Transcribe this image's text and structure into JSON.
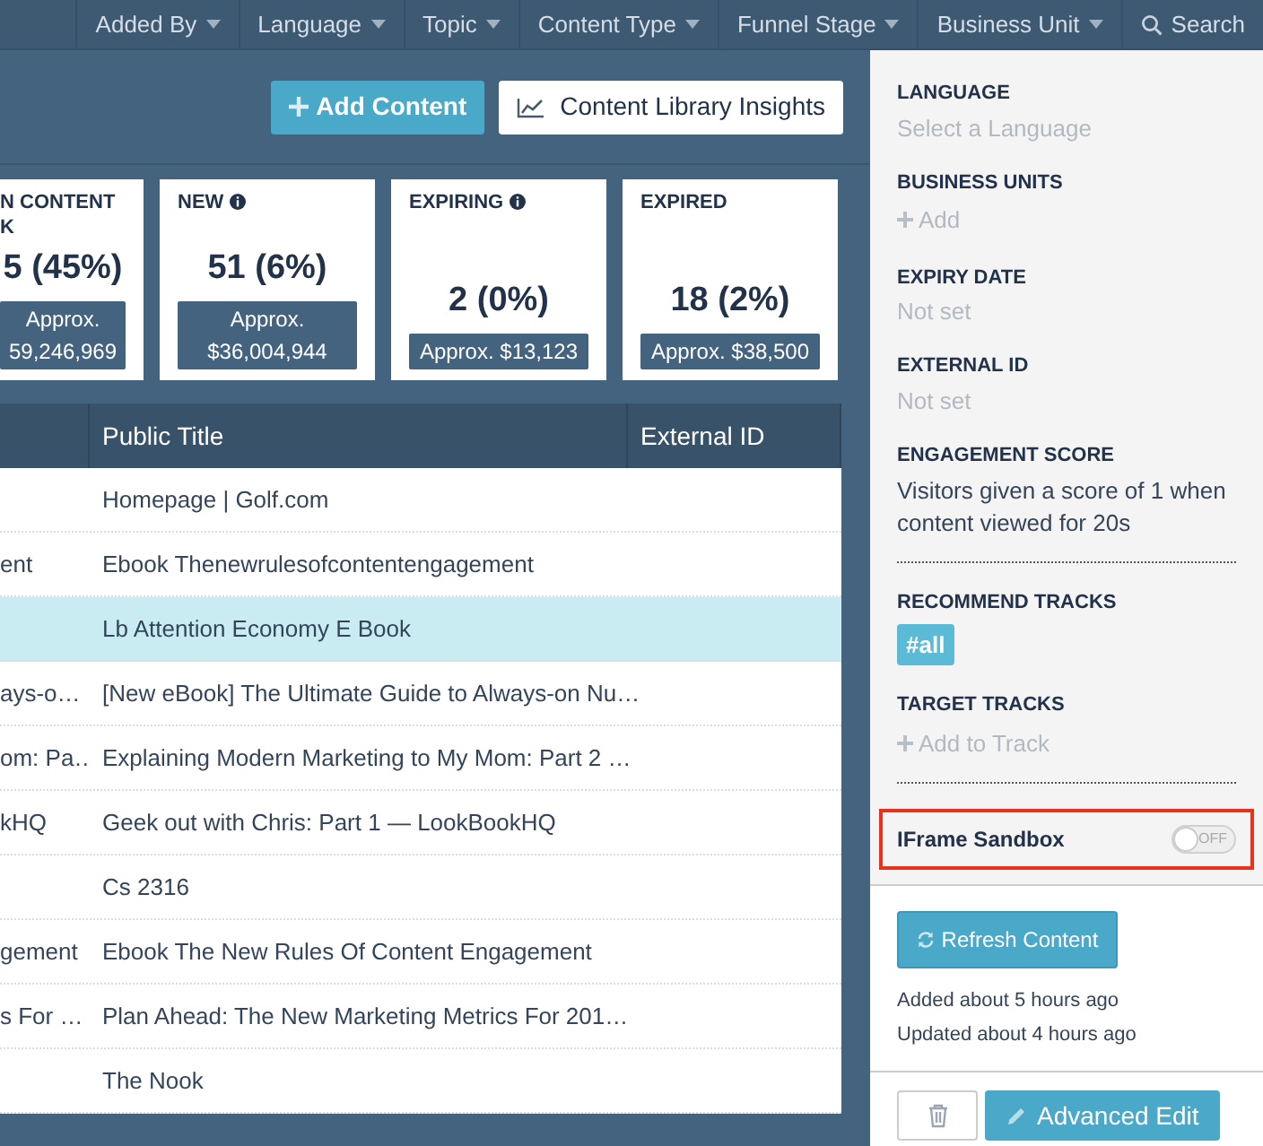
{
  "nav": {
    "items": [
      {
        "label": "Added By",
        "kind": "dropdown"
      },
      {
        "label": "Language",
        "kind": "dropdown"
      },
      {
        "label": "Topic",
        "kind": "dropdown"
      },
      {
        "label": "Content Type",
        "kind": "dropdown"
      },
      {
        "label": "Funnel Stage",
        "kind": "dropdown"
      },
      {
        "label": "Business Unit",
        "kind": "dropdown"
      },
      {
        "label": "Search",
        "kind": "search"
      }
    ]
  },
  "toolbar": {
    "add_button": "Add Content",
    "insights_button": "Content Library Insights"
  },
  "stat_cards": [
    {
      "title_lines": [
        "N CONTENT",
        "K"
      ],
      "info": false,
      "value": "5 (45%)",
      "approx_lines": [
        "Approx.",
        "59,246,969"
      ]
    },
    {
      "title_lines": [
        "NEW"
      ],
      "info": true,
      "value": "51 (6%)",
      "approx_lines": [
        "Approx.",
        "$36,004,944"
      ]
    },
    {
      "title_lines": [
        "EXPIRING"
      ],
      "info": true,
      "value": "2 (0%)",
      "approx_lines": [
        "Approx. $13,123"
      ]
    },
    {
      "title_lines": [
        "EXPIRED"
      ],
      "info": false,
      "value": "18 (2%)",
      "approx_lines": [
        "Approx. $38,500"
      ]
    }
  ],
  "table": {
    "columns": [
      "Public Title",
      "External ID"
    ],
    "rows": [
      {
        "column_1": "",
        "public_title": "Homepage | Golf.com",
        "selected": false
      },
      {
        "column_1": "ent",
        "public_title": "Ebook Thenewrulesofcontentengagement",
        "selected": false
      },
      {
        "column_1": "",
        "public_title": "Lb Attention Economy E Book",
        "selected": true
      },
      {
        "column_1": "ays-o…",
        "public_title": "[New eBook] The Ultimate Guide to Always-on Nu…",
        "selected": false
      },
      {
        "column_1": "om: Pa…",
        "public_title": "Explaining Modern Marketing to My Mom: Part 2 …",
        "selected": false
      },
      {
        "column_1": "kHQ",
        "public_title": "Geek out with Chris: Part 1 — LookBookHQ",
        "selected": false
      },
      {
        "column_1": "",
        "public_title": "Cs 2316",
        "selected": false
      },
      {
        "column_1": "gement",
        "public_title": "Ebook The New Rules Of Content Engagement",
        "selected": false
      },
      {
        "column_1": "s For …",
        "public_title": "Plan Ahead: The New Marketing Metrics For 201…",
        "selected": false
      },
      {
        "column_1": "",
        "public_title": "The Nook",
        "selected": false
      }
    ]
  },
  "details": {
    "fields": [
      {
        "label": "LANGUAGE",
        "kind": "placeholder",
        "placeholder": "Select a Language",
        "divider_after": false
      },
      {
        "label": "BUSINESS UNITS",
        "kind": "add",
        "value": "Add",
        "divider_after": false
      },
      {
        "label": "EXPIRY DATE",
        "kind": "placeholder",
        "placeholder": "Not set",
        "divider_after": false
      },
      {
        "label": "EXTERNAL ID",
        "kind": "placeholder",
        "placeholder": "Not set",
        "divider_after": false
      },
      {
        "label": "ENGAGEMENT SCORE",
        "kind": "text",
        "value": "Visitors given a score of 1 when content viewed for 20s",
        "divider_after": true
      },
      {
        "label": "RECOMMEND TRACKS",
        "kind": "tag",
        "value": "#all",
        "divider_after": false
      },
      {
        "label": "TARGET TRACKS",
        "kind": "add",
        "value": "Add to Track",
        "divider_after": true
      }
    ],
    "iframe_sandbox": {
      "label": "IFrame Sandbox",
      "on": false,
      "state_text": "OFF"
    },
    "refresh_button": "Refresh Content",
    "meta": [
      "Added about 5 hours ago",
      "Updated about 4 hours ago"
    ],
    "advanced_edit_button": "Advanced Edit"
  }
}
